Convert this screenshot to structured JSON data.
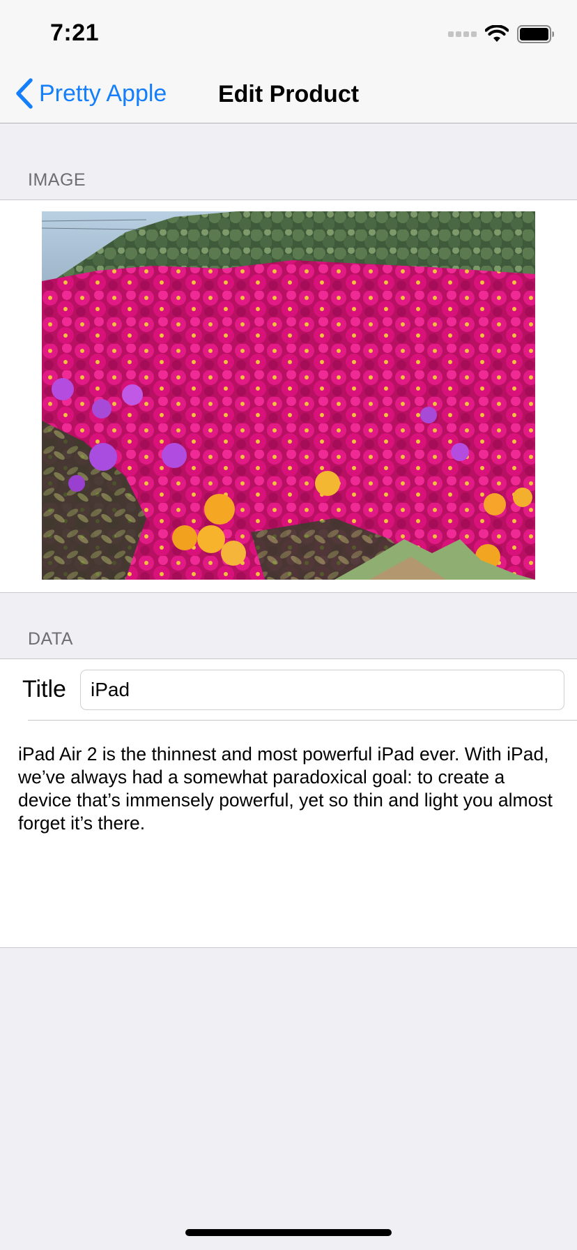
{
  "status_bar": {
    "time": "7:21",
    "icons": [
      "signal-icon",
      "wifi-icon",
      "battery-icon"
    ]
  },
  "nav": {
    "back_label": "Pretty Apple",
    "back_icon": "chevron-left-icon",
    "title": "Edit Product"
  },
  "sections": {
    "image_header": "IMAGE",
    "data_header": "DATA"
  },
  "image": {
    "subject": "flower-field-photo"
  },
  "form": {
    "title_label": "Title",
    "title_value": "iPad",
    "description": "iPad Air 2 is the thinnest and most powerful iPad ever. With iPad, we’ve always had a somewhat paradoxical goal: to create a device that’s immensely powerful, yet so thin and light you almost forget it’s there."
  },
  "colors": {
    "accent": "#147efb",
    "background": "#efeff4",
    "section_header": "#6d6d72"
  }
}
